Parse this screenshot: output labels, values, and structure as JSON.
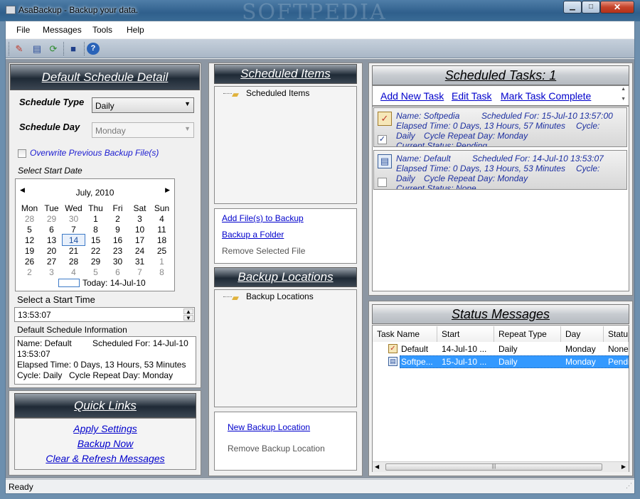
{
  "window": {
    "title": "AsaBackup - Backup your data.",
    "watermark": "SOFTPEDIA",
    "minimize": "▁",
    "maximize": "□",
    "close": "✕"
  },
  "menu": [
    "File",
    "Messages",
    "Tools",
    "Help"
  ],
  "toolbar": {
    "icons": [
      "checklist-icon",
      "book-icon",
      "refresh-icon",
      "save-icon",
      "help-icon"
    ]
  },
  "schedule_detail": {
    "title": "Default Schedule Detail",
    "type_label": "Schedule Type",
    "type_value": "Daily",
    "day_label": "Schedule Day",
    "day_value": "Monday",
    "overwrite_label": "Overwrite Previous Backup File(s)",
    "start_date_label": "Select Start Date",
    "calendar": {
      "month": "July, 2010",
      "weekdays": [
        "Mon",
        "Tue",
        "Wed",
        "Thu",
        "Fri",
        "Sat",
        "Sun"
      ],
      "weeks": [
        [
          "28",
          "29",
          "30",
          "1",
          "2",
          "3",
          "4"
        ],
        [
          "5",
          "6",
          "7",
          "8",
          "9",
          "10",
          "11"
        ],
        [
          "12",
          "13",
          "14",
          "15",
          "16",
          "17",
          "18"
        ],
        [
          "19",
          "20",
          "21",
          "22",
          "23",
          "24",
          "25"
        ],
        [
          "26",
          "27",
          "28",
          "29",
          "30",
          "31",
          "1"
        ],
        [
          "2",
          "3",
          "4",
          "5",
          "6",
          "7",
          "8"
        ]
      ],
      "selected": "14",
      "today": "Today: 14-Jul-10"
    },
    "start_time_label": "Select a Start Time",
    "start_time_value": "13:53:07",
    "info_label": "Default Schedule Information",
    "info": {
      "line1_name": "Name: Default",
      "line1_sched": "Scheduled For: 14-Jul-10",
      "line2": "13:53:07",
      "line3": "Elapsed Time: 0 Days, 13 Hours, 53 Minutes",
      "line4_cycle": "Cycle: Daily",
      "line4_repeat": "Cycle Repeat Day: Monday"
    }
  },
  "quick_links": {
    "title": "Quick Links",
    "items": [
      "Apply Settings",
      "Backup Now",
      "Clear & Refresh Messages"
    ]
  },
  "scheduled_items": {
    "title": "Scheduled Items",
    "tree_root": "Scheduled Items",
    "actions": {
      "add_files": "Add File(s) to Backup",
      "backup_folder": "Backup a Folder",
      "remove_file": "Remove Selected File"
    }
  },
  "backup_locations": {
    "title": "Backup Locations",
    "tree_root": "Backup Locations",
    "actions": {
      "new": "New Backup Location",
      "remove": "Remove Backup Location"
    }
  },
  "scheduled_tasks": {
    "title": "Scheduled Tasks: 1",
    "links": {
      "add": "Add New Task",
      "edit": "Edit Task",
      "complete": "Mark Task Complete"
    },
    "tasks": [
      {
        "name": "Name: Softpedia",
        "sched": "Scheduled For: 15-Jul-10 13:57:00",
        "elapsed": "Elapsed Time: 0 Days, 13 Hours, 57 Minutes",
        "cycle_label": "Cycle:",
        "cycle": "Daily",
        "repeat": "Cycle Repeat Day: Monday",
        "status": "Current Status: Pending",
        "checked": true
      },
      {
        "name": "Name: Default",
        "sched": "Scheduled For: 14-Jul-10 13:53:07",
        "elapsed": "Elapsed Time: 0 Days, 13 Hours, 53 Minutes",
        "cycle_label": "Cycle:",
        "cycle": "Daily",
        "repeat": "Cycle Repeat Day: Monday",
        "status": "Current Status: None",
        "checked": false
      }
    ]
  },
  "status_messages": {
    "title": "Status Messages",
    "columns": [
      "Task Name",
      "Start",
      "Repeat Type",
      "Day",
      "Statu"
    ],
    "rows": [
      {
        "name": "Default",
        "start": "14-Jul-10 ...",
        "repeat": "Daily",
        "day": "Monday",
        "status": "None",
        "selected": false
      },
      {
        "name": "Softpe...",
        "start": "15-Jul-10 ...",
        "repeat": "Daily",
        "day": "Monday",
        "status": "Pendi",
        "selected": true
      }
    ]
  },
  "statusbar": {
    "text": "Ready"
  }
}
